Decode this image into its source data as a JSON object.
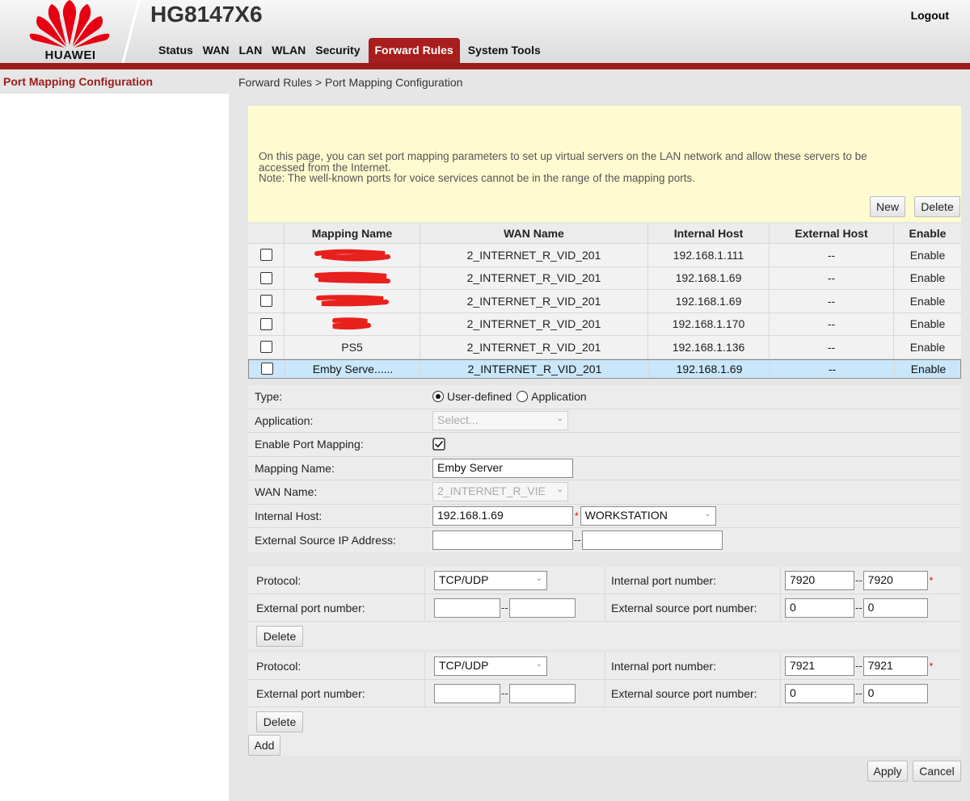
{
  "header": {
    "brand": "HUAWEI",
    "model": "HG8147X6",
    "logout_label": "Logout",
    "nav": [
      "Status",
      "WAN",
      "LAN",
      "WLAN",
      "Security",
      "Forward Rules",
      "System Tools"
    ],
    "active_nav": "Forward Rules"
  },
  "sidebar": {
    "items": [
      {
        "label": "Port Mapping Configuration"
      }
    ]
  },
  "breadcrumb": "Forward Rules > Port Mapping Configuration",
  "notice": {
    "line1": "On this page, you can set port mapping parameters to set up virtual servers on the LAN network and allow these servers to be",
    "line2": "accessed from the Internet.",
    "line3": "Note: The well-known ports for voice services cannot be in the range of the mapping ports."
  },
  "table_actions": {
    "new_label": "New",
    "delete_label": "Delete"
  },
  "table": {
    "headers": [
      "Mapping Name",
      "WAN Name",
      "Internal Host",
      "External Host",
      "Enable"
    ],
    "rows": [
      {
        "name": "",
        "wan": "2_INTERNET_R_VID_201",
        "host": "192.168.1.111",
        "ext": "--",
        "enable": "Enable"
      },
      {
        "name": "",
        "wan": "2_INTERNET_R_VID_201",
        "host": "192.168.1.69",
        "ext": "--",
        "enable": "Enable"
      },
      {
        "name": "",
        "wan": "2_INTERNET_R_VID_201",
        "host": "192.168.1.69",
        "ext": "--",
        "enable": "Enable"
      },
      {
        "name": "",
        "wan": "2_INTERNET_R_VID_201",
        "host": "192.168.1.170",
        "ext": "--",
        "enable": "Enable"
      },
      {
        "name": "PS5",
        "wan": "2_INTERNET_R_VID_201",
        "host": "192.168.1.136",
        "ext": "--",
        "enable": "Enable"
      },
      {
        "name": "Emby Serve......",
        "wan": "2_INTERNET_R_VID_201",
        "host": "192.168.1.69",
        "ext": "--",
        "enable": "Enable"
      }
    ],
    "selected_row": 5,
    "redaction_color": "#e8201e"
  },
  "form": {
    "type_label": "Type:",
    "type_options": [
      "User-defined",
      "Application"
    ],
    "application_label": "Application:",
    "application_placeholder": "Select...",
    "enable_label": "Enable Port Mapping:",
    "mapping_name_label": "Mapping Name:",
    "mapping_name_value": "Emby Server",
    "wan_name_label": "WAN Name:",
    "wan_name_value": "2_INTERNET_R_VIE",
    "internal_host_label": "Internal Host:",
    "internal_host_value": "192.168.1.69",
    "internal_host_device": "WORKSTATION",
    "ext_src_ip_label": "External Source IP Address:"
  },
  "port_blocks": [
    {
      "protocol_label": "Protocol:",
      "protocol_value": "TCP/UDP",
      "internal_port_label": "Internal port number:",
      "internal_port_start": "7920",
      "internal_port_end": "7920",
      "external_port_label": "External port number:",
      "external_port_start": "",
      "external_port_end": "",
      "ext_src_port_label": "External source port number:",
      "ext_src_port_start": "0",
      "ext_src_port_end": "0",
      "delete_label": "Delete"
    },
    {
      "protocol_label": "Protocol:",
      "protocol_value": "TCP/UDP",
      "internal_port_label": "Internal port number:",
      "internal_port_start": "7921",
      "internal_port_end": "7921",
      "external_port_label": "External port number:",
      "external_port_start": "",
      "external_port_end": "",
      "ext_src_port_label": "External source port number:",
      "ext_src_port_start": "0",
      "ext_src_port_end": "0",
      "delete_label": "Delete"
    }
  ],
  "actions": {
    "add_label": "Add",
    "apply_label": "Apply",
    "cancel_label": "Cancel"
  },
  "colors": {
    "accent": "#a81d1d",
    "notice_bg": "#fffbd0",
    "selected_row": "#c9e6fb"
  }
}
